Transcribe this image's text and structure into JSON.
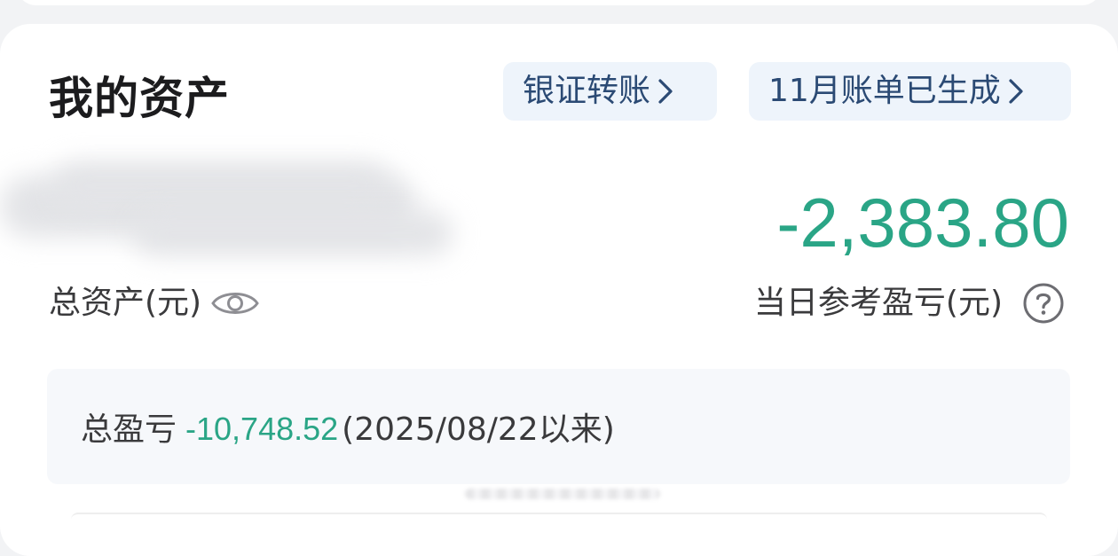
{
  "header": {
    "title": "我的资产",
    "actions": [
      {
        "label": "银证转账",
        "icon": "chevron-right-icon"
      },
      {
        "label": "11月账单已生成",
        "icon": "chevron-right-icon"
      }
    ]
  },
  "total_assets": {
    "label": "总资产(元)",
    "value_obscured": true,
    "toggle_icon": "eye-icon"
  },
  "daily_pl": {
    "value": "-2,383.80",
    "label": "当日参考盈亏(元)",
    "help_icon": "question-circle-icon",
    "color": "#2aa586"
  },
  "summary": {
    "label": "总盈亏",
    "value": "-10,748.52",
    "since": "(2025/08/22以来)",
    "value_color": "#2aa586"
  },
  "colors": {
    "chip_bg": "#eef4fb",
    "chip_text": "#2b4a74",
    "negative": "#2aa586",
    "panel_bg": "#f6f8fb"
  }
}
